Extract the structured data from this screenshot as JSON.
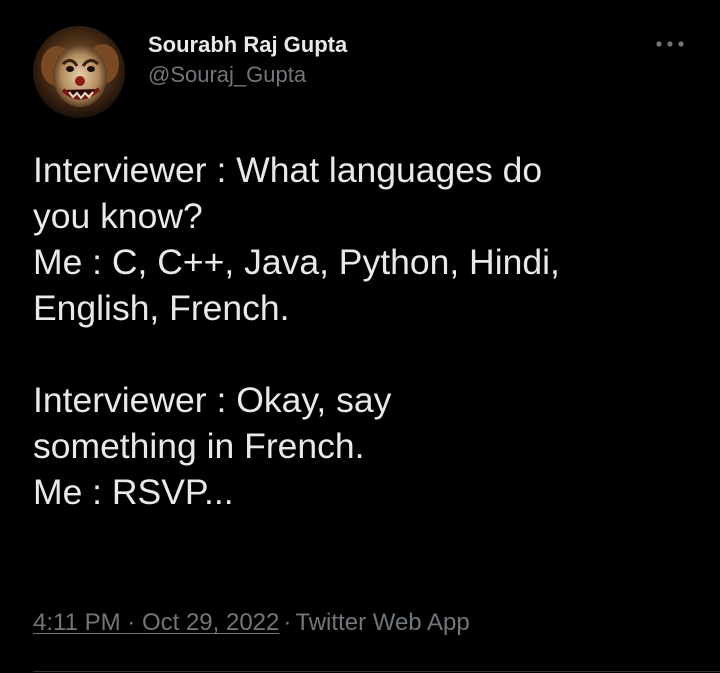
{
  "author": {
    "display_name": "Sourabh Raj Gupta",
    "handle": "@Souraj_Gupta",
    "avatar": "clown-face-avatar"
  },
  "tweet": {
    "lines": [
      "Interviewer : What languages do",
      "you know?",
      "Me : C, C++, Java, Python, Hindi,",
      "English, French.",
      "",
      "Interviewer : Okay, say",
      "something in French.",
      "Me : RSVP..."
    ]
  },
  "meta": {
    "time": "4:11 PM",
    "separator": "·",
    "date": "Oct 29, 2022",
    "source": "Twitter Web App"
  },
  "icons": {
    "more": "more-dots-icon"
  },
  "colors": {
    "background": "#000000",
    "primary_text": "#e7e9ea",
    "secondary_text": "#71767b",
    "divider": "#2f3336"
  }
}
